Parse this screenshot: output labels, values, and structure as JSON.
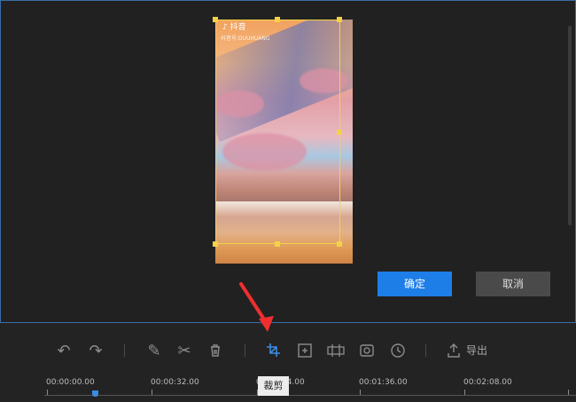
{
  "video": {
    "logo_text": "♪ 抖音",
    "logo_subtext": "抖音号:DUUHUANG"
  },
  "buttons": {
    "confirm": "确定",
    "cancel": "取消"
  },
  "toolbar": {
    "tooltip": "裁剪",
    "export_label": "导出",
    "icons": [
      "undo-icon",
      "redo-icon",
      "edit-icon",
      "cut-icon",
      "delete-icon",
      "crop-icon",
      "zoom-icon",
      "mosaic-icon",
      "screenshot-icon",
      "speed-icon",
      "export-icon"
    ]
  },
  "timeline": {
    "labels": [
      "00:00:00.00",
      "00:00:32.00",
      "00:01:04.00",
      "00:01:36.00",
      "00:02:08.00"
    ]
  },
  "colors": {
    "accent": "#1d7ee7",
    "crop_frame": "#f4d247",
    "playhead": "#3b8be2"
  }
}
